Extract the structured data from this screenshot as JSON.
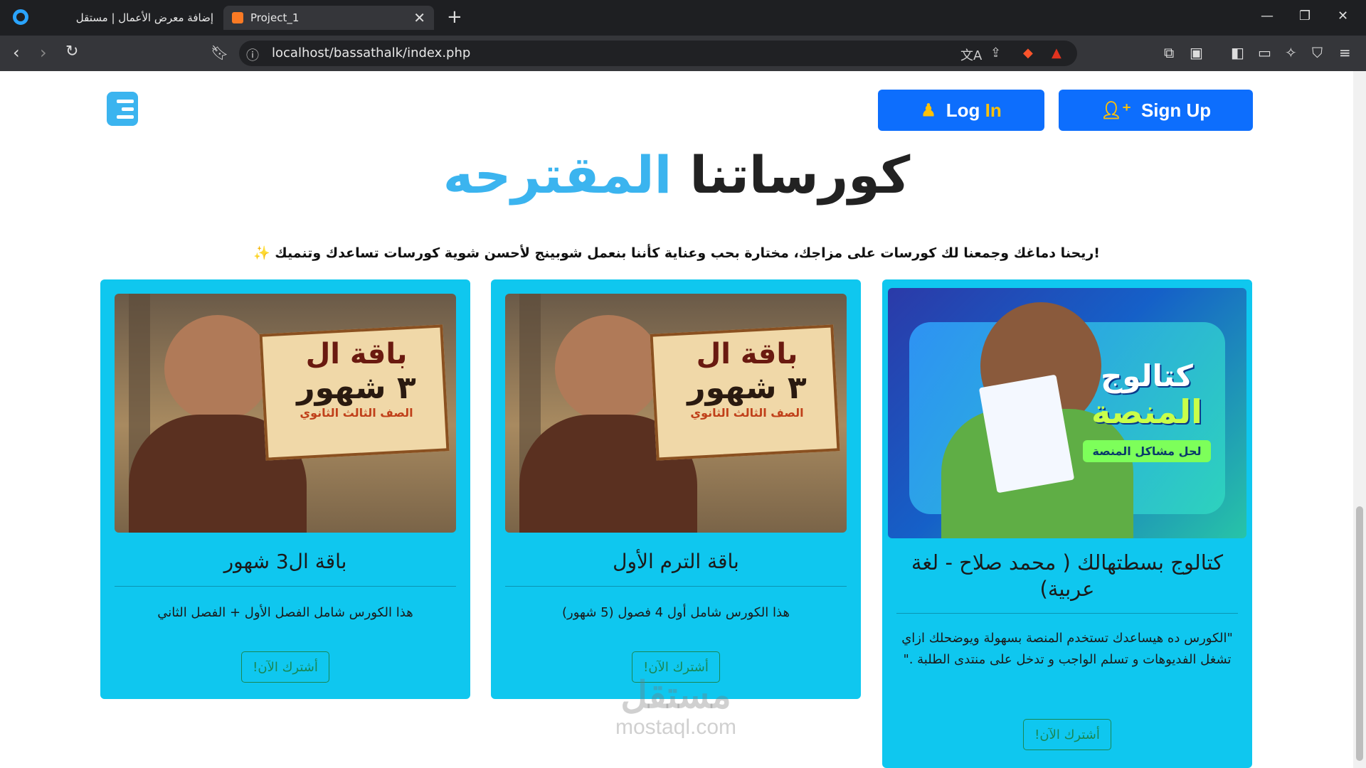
{
  "browser": {
    "tabs": [
      {
        "title": "إضافة معرض الأعمال | مستقل",
        "active": false
      },
      {
        "title": "Project_1",
        "active": true
      }
    ],
    "url": "localhost/bassathalk/index.php"
  },
  "header": {
    "login_label_1": "Log",
    "login_label_2": "In",
    "signup_label": "Sign Up"
  },
  "hero": {
    "title_main": "كورساتنا",
    "title_accent": "المقترحه",
    "subtitle": "!ريحنا دماغك وجمعنا لك كورسات على مزاجك، مختارة بحب وعناية كأننا بنعمل شوبينج لأحسن شوية كورسات تساعدك وتنميك ✨"
  },
  "cards": [
    {
      "title": "كتالوج بسطتهالك ( محمد صلاح - لغة عربية)",
      "description": "\"الكورس ده هيساعدك تستخدم المنصة بسهولة ويوضحلك ازاي تشغل الفديوهات و تسلم الواجب و تدخل على منتدى الطلبة .\"",
      "button": "أشترك الآن!",
      "image": {
        "line1": "كتالوج",
        "line2": "المنصة",
        "tagline": "لحل مشاكل المنصة"
      }
    },
    {
      "title": "باقة الترم الأول",
      "description": "هذا الكورس شامل أول 4 فصول (5 شهور)",
      "button": "أشترك الآن!",
      "image": {
        "line1": "باقة ال",
        "line2": "٣ شهور",
        "tagline": "الصف الثالث الثانوي"
      }
    },
    {
      "title": "باقة ال3 شهور",
      "description": "هذا الكورس شامل الفصل الأول + الفصل الثاني",
      "button": "أشترك الآن!",
      "image": {
        "line1": "باقة ال",
        "line2": "٣ شهور",
        "tagline": "الصف الثالث الثانوي"
      }
    }
  ],
  "watermark": {
    "arabic": "مستقل",
    "latin": "mostaql.com"
  }
}
